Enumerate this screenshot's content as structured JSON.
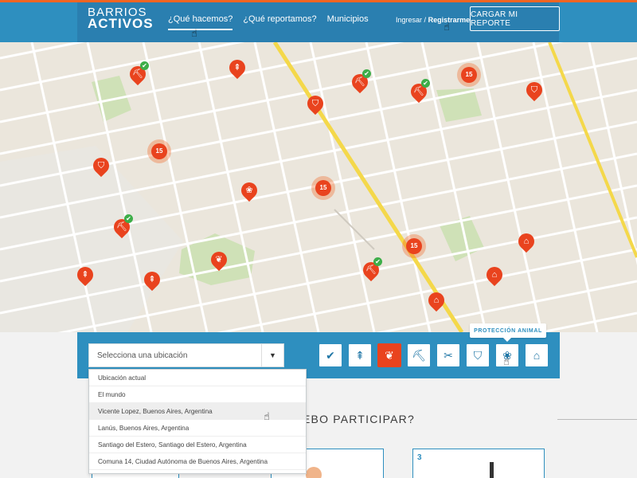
{
  "brand": {
    "line1": "BARRIOS",
    "line2": "ACTIVOS"
  },
  "nav": {
    "items": [
      "¿Qué hacemos?",
      "¿Qué reportamos?",
      "Municipios"
    ],
    "active_index": 0
  },
  "auth": {
    "login": "Ingresar",
    "separator": "/",
    "register": "Registrarme"
  },
  "cta": {
    "label": "CARGAR MI REPORTE"
  },
  "map": {
    "clusters": [
      "15",
      "15",
      "15",
      "15"
    ]
  },
  "filter": {
    "placeholder": "Selecciona una ubicación",
    "options": [
      "Ubicación actual",
      "El mundo",
      "Vicente Lopez, Buenos Aires, Argentina",
      "Lanús, Buenos Aires, Argentina",
      "Santiago del Estero, Santiago del Estero, Argentina",
      "Comuna 14, Ciudad Autónoma de Buenos Aires, Argentina"
    ],
    "hovered_option_index": 2,
    "categories": [
      {
        "name": "check-icon",
        "glyph": "✔"
      },
      {
        "name": "road-icon",
        "glyph": "⇞"
      },
      {
        "name": "leaf-icon",
        "glyph": "❦"
      },
      {
        "name": "construction-icon",
        "glyph": "⛏"
      },
      {
        "name": "tools-icon",
        "glyph": "✂"
      },
      {
        "name": "shield-icon",
        "glyph": "⛉"
      },
      {
        "name": "paw-icon",
        "glyph": "❀"
      },
      {
        "name": "building-icon",
        "glyph": "⌂"
      }
    ],
    "active_category_index": 2,
    "tooltip": "PROTECCIÓN ANIMAL"
  },
  "section": {
    "title_fragment": "EBO PARTICIPAR?"
  },
  "cards": [
    {
      "number": "3"
    }
  ],
  "colors": {
    "primary": "#2e8fbf",
    "accent": "#e9431e",
    "success": "#3dae49"
  }
}
